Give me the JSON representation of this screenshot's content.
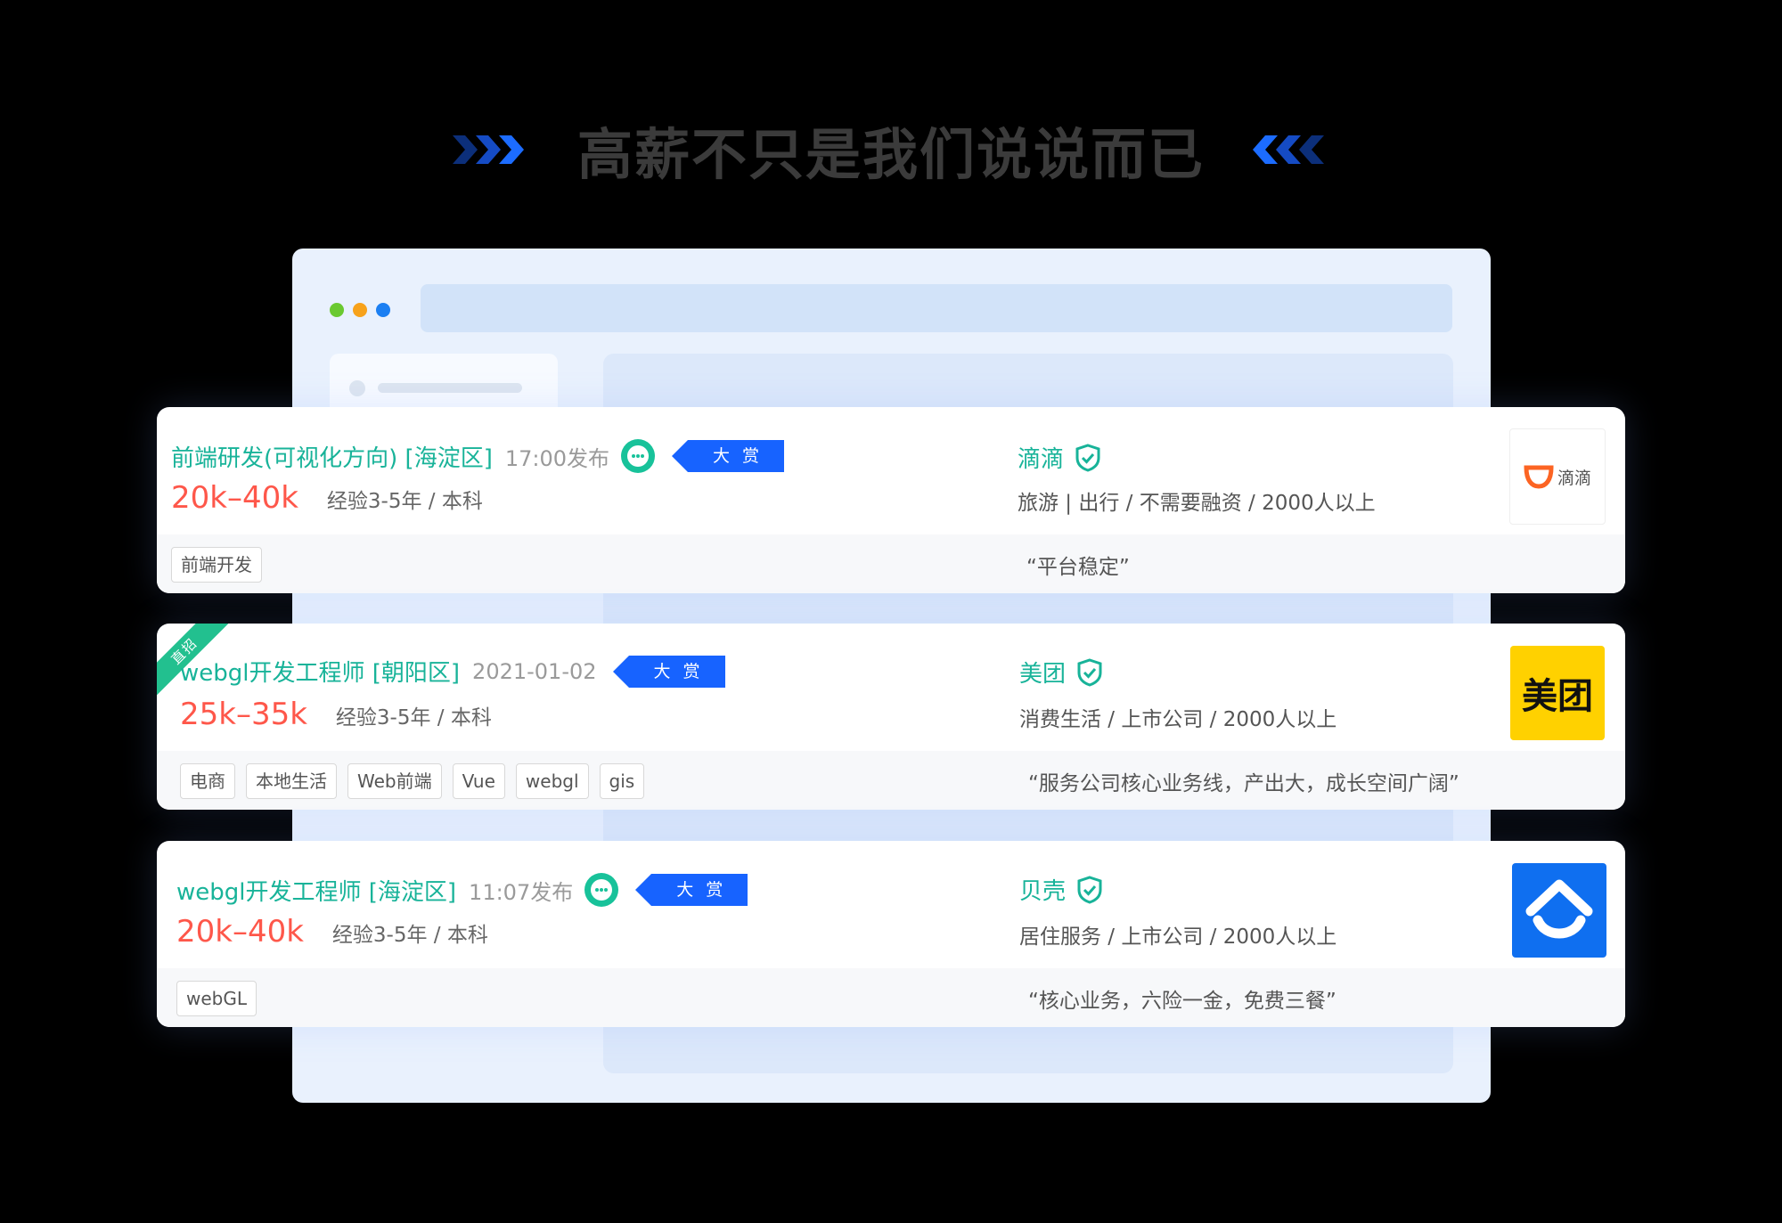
{
  "headline": "高薪不只是我们说说而已",
  "colors": {
    "accent_blue": "#1763ff",
    "teal": "#18b399",
    "salary_red": "#fe574a",
    "dot_green": "#6ac930",
    "dot_orange": "#f7a21b",
    "dot_blue": "#1b7ff2"
  },
  "jobs": [
    {
      "title": "前端研发(可视化方向) [海淀区]",
      "time": "17:00发布",
      "badge": "大赏",
      "chat_icon": "chat-bubble-icon",
      "salary": "20k–40k",
      "requirements": "经验3-5年 / 本科",
      "tags": [
        "前端开发"
      ],
      "company": "滴滴",
      "company_info": "旅游 | 出行 / 不需要融资 / 2000人以上",
      "quote": "“平台稳定”",
      "logo_text": "滴滴",
      "logo_icon": "didi-logo"
    },
    {
      "ribbon": "直招",
      "title": "webgl开发工程师 [朝阳区]",
      "time": "2021-01-02",
      "badge": "大赏",
      "salary": "25k–35k",
      "requirements": "经验3-5年 / 本科",
      "tags": [
        "电商",
        "本地生活",
        "Web前端",
        "Vue",
        "webgl",
        "gis"
      ],
      "company": "美团",
      "company_info": "消费生活 / 上市公司 / 2000人以上",
      "quote": "“服务公司核心业务线，产出大，成长空间广阔”",
      "logo_text": "美团",
      "logo_icon": "meituan-logo"
    },
    {
      "title": "webgl开发工程师 [海淀区]",
      "time": "11:07发布",
      "badge": "大赏",
      "chat_icon": "chat-bubble-icon",
      "salary": "20k–40k",
      "requirements": "经验3-5年 / 本科",
      "tags": [
        "webGL"
      ],
      "company": "贝壳",
      "company_info": "居住服务 / 上市公司 / 2000人以上",
      "quote": "“核心业务，六险一金，免费三餐”",
      "logo_icon": "beike-logo"
    }
  ]
}
